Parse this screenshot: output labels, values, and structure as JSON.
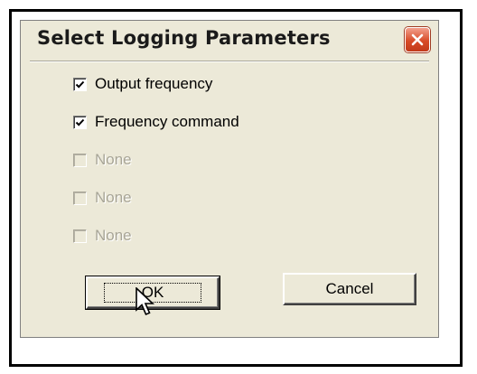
{
  "dialog": {
    "title": "Select Logging Parameters",
    "close_icon": "close-x-icon",
    "close_color": "#d84b28"
  },
  "parameters": [
    {
      "label": "Output frequency",
      "checked": true,
      "enabled": true
    },
    {
      "label": "Frequency command",
      "checked": true,
      "enabled": true
    },
    {
      "label": "None",
      "checked": false,
      "enabled": false
    },
    {
      "label": "None",
      "checked": false,
      "enabled": false
    },
    {
      "label": "None",
      "checked": false,
      "enabled": false
    }
  ],
  "buttons": {
    "ok_label": "OK",
    "cancel_label": "Cancel"
  },
  "cursor": "arrow-pointer-icon"
}
